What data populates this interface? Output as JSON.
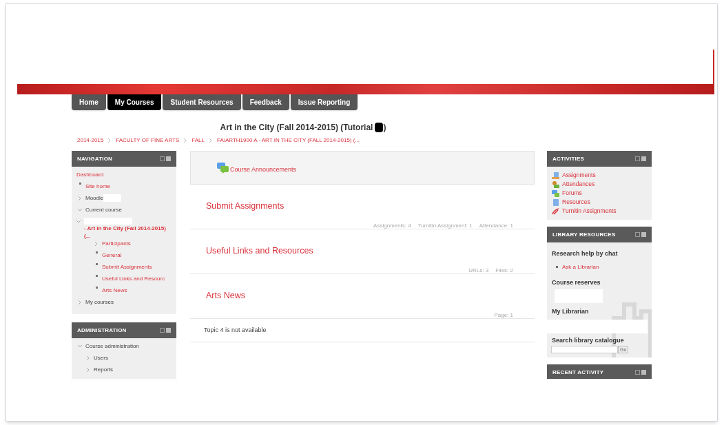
{
  "tabs": [
    {
      "label": "Home",
      "selected": false
    },
    {
      "label": "My Courses",
      "selected": true
    },
    {
      "label": "Student Resources",
      "selected": false
    },
    {
      "label": "Feedback",
      "selected": false
    },
    {
      "label": "Issue Reporting",
      "selected": false
    }
  ],
  "page_title": {
    "before_redaction": "Art in the City (Fall 2014-2015) (Tutorial",
    "after_redaction": ")"
  },
  "breadcrumb": [
    "2014-2015",
    "FACULTY OF FINE ARTS",
    "FALL",
    "FA/ARTH1900 A - ART IN THE CITY (FALL 2014-2015) (..."
  ],
  "navigation": {
    "title": "NAVIGATION",
    "items": [
      {
        "label": "Dashboard",
        "kind": "plain",
        "link": true
      },
      {
        "label": "Site home",
        "kind": "bullet",
        "link": true
      },
      {
        "label": "Moodle",
        "kind": "collapsed",
        "link": false,
        "redacted_after": true
      },
      {
        "label": "Current course",
        "kind": "expanded",
        "link": false,
        "children": [
          {
            "label": "- Art in the City (Fall 2014-2015) (...",
            "kind": "expanded",
            "link": true,
            "current": true,
            "redacted_before": true,
            "children": [
              {
                "label": "Participants",
                "kind": "collapsed",
                "link": true
              },
              {
                "label": "General",
                "kind": "bullet",
                "link": true
              },
              {
                "label": "Submit Assignments",
                "kind": "bullet",
                "link": true
              },
              {
                "label": "Useful Links and Resourc",
                "kind": "bullet",
                "link": true
              },
              {
                "label": "Arts News",
                "kind": "bullet",
                "link": true
              }
            ]
          }
        ]
      },
      {
        "label": "My courses",
        "kind": "collapsed",
        "link": false
      }
    ]
  },
  "administration": {
    "title": "ADMINISTRATION",
    "items": [
      {
        "label": "Course administration",
        "kind": "expanded",
        "link": false,
        "children": [
          {
            "label": "Users",
            "kind": "collapsed",
            "link": false
          },
          {
            "label": "Reports",
            "kind": "collapsed",
            "link": false
          }
        ]
      }
    ]
  },
  "announcements": {
    "label": "Course Announcements"
  },
  "sections": [
    {
      "title": "Submit Assignments",
      "summary": [
        "Assignments: 4",
        "Turnitin Assignment: 1",
        "Attendance: 1"
      ]
    },
    {
      "title": "Useful Links and Resources",
      "summary": [
        "URLs: 3",
        "Files: 2"
      ]
    },
    {
      "title": "Arts News",
      "summary": [
        "Page: 1"
      ]
    }
  ],
  "unavailable_note": "Topic 4 is not available",
  "activities": {
    "title": "ACTIVITIES",
    "items": [
      {
        "label": "Assignments",
        "kind": "assignment"
      },
      {
        "label": "Attendances",
        "kind": "attendance"
      },
      {
        "label": "Forums",
        "kind": "forum"
      },
      {
        "label": "Resources",
        "kind": "resource"
      },
      {
        "label": "Turnitin Assignments",
        "kind": "turnitin"
      }
    ]
  },
  "library": {
    "title": "LIBRARY RESOURCES",
    "chat_heading": "Research help by chat",
    "chat_link": "Ask a Librarian",
    "reserves_heading": "Course reserves",
    "librarian_heading": "My Librarian",
    "search_heading": "Search library catalogue",
    "go_button": "Go"
  },
  "recent_activity": {
    "title": "RECENT ACTIVITY"
  }
}
